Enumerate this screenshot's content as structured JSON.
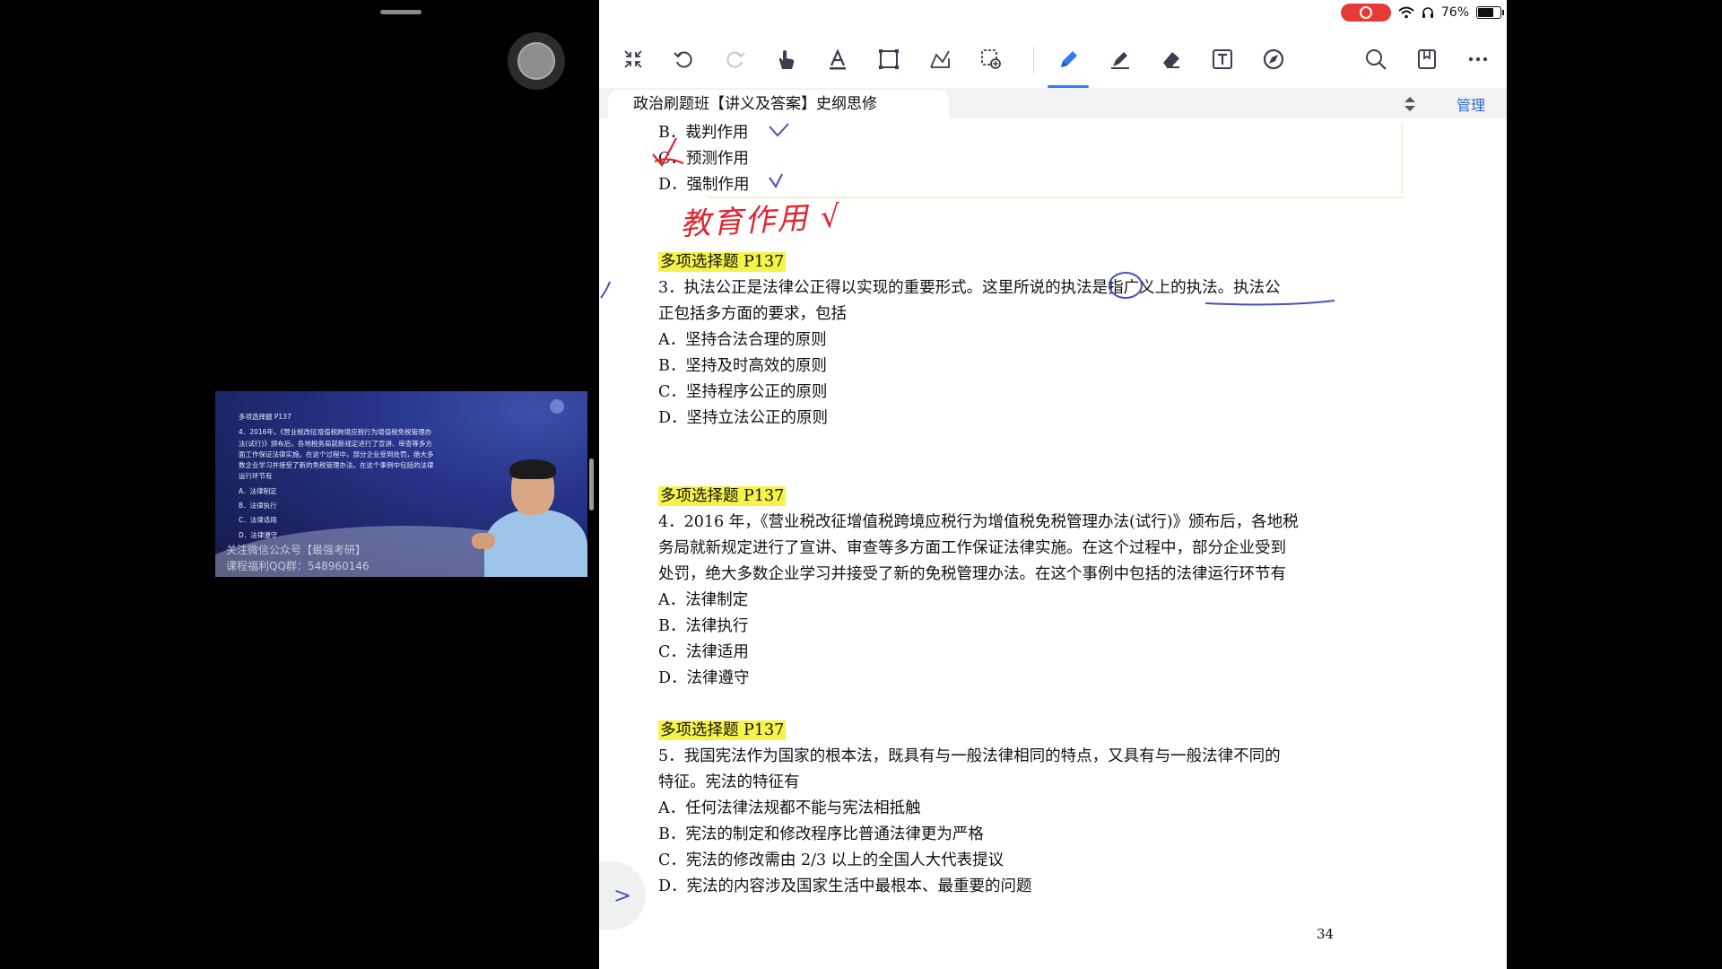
{
  "status_bar": {
    "battery": "76%"
  },
  "toolbar": {
    "tools": [
      "collapse-icon",
      "undo-icon",
      "redo-icon",
      "hand-icon",
      "text-select-icon",
      "crop-icon",
      "shape-icon",
      "lasso-icon",
      "pen-icon",
      "highlighter-icon",
      "eraser-icon",
      "textbox-icon",
      "compass-icon",
      "search-icon",
      "bookmark-icon",
      "more-icon"
    ],
    "active_tool": "pen-icon"
  },
  "tab": {
    "title": "政治刷题班【讲义及答案】史纲思修",
    "manage_label": "管理"
  },
  "video": {
    "slide_lines": [
      "多项选择题 P137",
      "4．2016年，《营业税改征增值税跨境应税行为增值税免税管理办",
      "法(试行)》颁布后，各地税务局就新规定进行了宣讲、审查等多方",
      "面工作保证法律实施。在这个过程中，部分企业受到处罚，绝大多",
      "数企业学习并接受了新的免税管理办法。在这个事例中包括的法律",
      "运行环节有",
      "A．法律制定",
      "B．法律执行",
      "C．法律适用",
      "D．法律遵守"
    ],
    "watermark_1": "关注微信公众号【最强考研】",
    "watermark_2": "课程福利QQ群：548960146"
  },
  "document": {
    "prev_options": [
      "B．裁判作用",
      "C．预测作用",
      "D．强制作用"
    ],
    "handwritten_note": "教育作用 √",
    "questions": [
      {
        "tag": "多项选择题  P137",
        "stem": [
          "3．执法公正是法律公正得以实现的重要形式。这里所说的执法是指广义上的执法。执法公",
          "正包括多方面的要求，包括"
        ],
        "options": [
          "A．坚持合法合理的原则",
          "B．坚持及时高效的原则",
          "C．坚持程序公正的原则",
          "D．坚持立法公正的原则"
        ]
      },
      {
        "tag": "多项选择题  P137",
        "stem": [
          "4．2016 年，《营业税改征增值税跨境应税行为增值税免税管理办法(试行)》颁布后，各地税",
          "务局就新规定进行了宣讲、审查等多方面工作保证法律实施。在这个过程中，部分企业受到",
          "处罚，绝大多数企业学习并接受了新的免税管理办法。在这个事例中包括的法律运行环节有"
        ],
        "options": [
          "A．法律制定",
          "B．法律执行",
          "C．法律适用",
          "D．法律遵守"
        ]
      },
      {
        "tag": "多项选择题  P137",
        "stem": [
          "5．我国宪法作为国家的根本法，既具有与一般法律相同的特点，又具有与一般法律不同的",
          "特征。宪法的特征有"
        ],
        "options": [
          "A．任何法律法规都不能与宪法相抵触",
          "B．宪法的制定和修改程序比普通法律更为严格",
          "C．宪法的修改需由 2/3 以上的全国人大代表提议",
          "D．宪法的内容涉及国家生活中最根本、最重要的问题"
        ]
      }
    ],
    "page_number": "34"
  }
}
